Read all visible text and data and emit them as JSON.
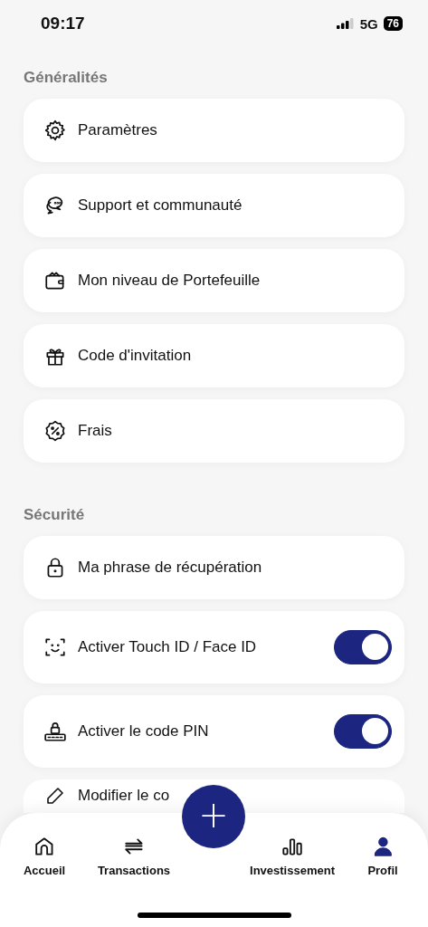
{
  "status_bar": {
    "time": "09:17",
    "network": "5G",
    "battery": "76"
  },
  "sections": [
    {
      "title": "Généralités",
      "items": [
        {
          "kind": "link",
          "label": "Paramètres"
        },
        {
          "kind": "link",
          "label": "Support et communauté"
        },
        {
          "kind": "link",
          "label": "Mon niveau de Portefeuille"
        },
        {
          "kind": "link",
          "label": "Code d'invitation"
        },
        {
          "kind": "link",
          "label": "Frais"
        }
      ]
    },
    {
      "title": "Sécurité",
      "items": [
        {
          "kind": "link",
          "label": "Ma phrase de récupération"
        },
        {
          "kind": "toggle",
          "label": "Activer Touch ID / Face ID",
          "on": true
        },
        {
          "kind": "toggle",
          "label": "Activer le code PIN",
          "on": true
        },
        {
          "kind": "link",
          "label": "Modifier le co"
        }
      ]
    }
  ],
  "fab": {
    "label": "+"
  },
  "tab_bar": [
    {
      "label": "Accueil",
      "selected": false
    },
    {
      "label": "Transactions",
      "selected": false
    },
    {
      "label": "Investissement",
      "selected": false
    },
    {
      "label": "Profil",
      "selected": true
    }
  ]
}
